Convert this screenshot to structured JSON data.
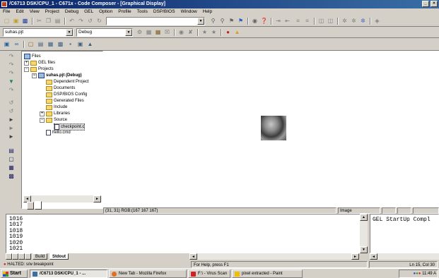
{
  "window": {
    "title": "/C6713 DSK/CPU_1 - C671x - Code Composer - [Graphical Display]",
    "minimize": "_",
    "close": "×"
  },
  "menu": [
    "File",
    "Edit",
    "View",
    "Project",
    "Debug",
    "GEL",
    "Option",
    "Profile",
    "Tools",
    "DSP/BIOS",
    "Window",
    "Help"
  ],
  "toolbar": {
    "search_value": "",
    "project_combo": "suhas.pjt",
    "config_combo": "Debug",
    "project_combo_arrow": "▼",
    "config_combo_arrow": "▼",
    "search_combo_arrow": "▼",
    "build_combo_arrow": "▼"
  },
  "tree": {
    "root": "Files",
    "gel": "GEL files",
    "projects": "Projects",
    "project": "suhas.pjt (Debug)",
    "dependent": "Dependent Project",
    "documents": "Documents",
    "dspbios": "DSP/BIOS Config",
    "generated": "Generated Files",
    "include": "Include",
    "libraries": "Libraries",
    "source": "Source",
    "checkpoint": "checkpoint.c",
    "cmd": "hello.cmd",
    "expand_minus": "−",
    "expand_plus": "+"
  },
  "tree_tabs": {
    "left_arrow": "◄",
    "right_arrow": "►"
  },
  "graph_status": {
    "coords": "(31, 31) RGB:(167 167 167)",
    "mode": "Image"
  },
  "output": {
    "lines": [
      "1016",
      "1017",
      "1018",
      "1019",
      "1020",
      "1021"
    ],
    "tab_build": "Build",
    "tab_stdout": "Stdout",
    "scroll_up": "▲",
    "scroll_down": "▼"
  },
  "gel": {
    "text": "GEL StartUp Compl"
  },
  "status": {
    "halted": "HALTED: s/w breakpoint",
    "help": "For Help, press F1",
    "position": "Ln 15, Col 30"
  },
  "taskbar": {
    "start": "Start",
    "tasks": [
      {
        "label": "/C6713 DSK/CPU_1 - ...",
        "color": "#3a6ea5"
      },
      {
        "label": "New Tab - Mozilla Firefox",
        "color": "#e07020"
      },
      {
        "label": "F:\\ - Virus Scan",
        "color": "#d02020"
      },
      {
        "label": "pixel extracted - Paint",
        "color": "#f0c000"
      }
    ],
    "clock": "11:49 A"
  },
  "colors": {
    "title_start": "#0a246a",
    "title_end": "#3a6ea5",
    "face": "#d4d0c8"
  }
}
